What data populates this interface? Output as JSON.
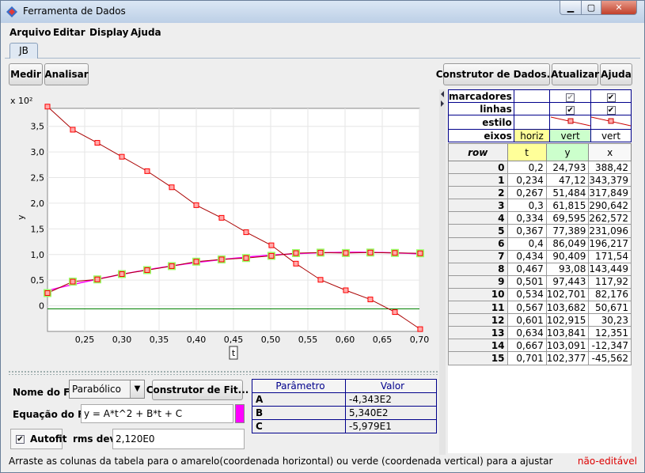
{
  "window": {
    "title": "Ferramenta de Dados"
  },
  "menu": [
    "Arquivo",
    "Editar",
    "Display",
    "Ajuda"
  ],
  "tab": "JB",
  "toolbar": {
    "measure": "Medir",
    "analyze": "Analisar",
    "builder": "Construtor de Dados...",
    "refresh": "Atualizar",
    "help": "Ajuda"
  },
  "props": {
    "rows": [
      "marcadores",
      "linhas",
      "estilo",
      "eixos"
    ],
    "axes": [
      "horiz",
      "vert",
      "vert"
    ]
  },
  "table": {
    "headers": [
      "row",
      "t",
      "y",
      "x"
    ],
    "rows": [
      [
        "0",
        "0,2",
        "24,793",
        "388,42"
      ],
      [
        "1",
        "0,234",
        "47,12",
        "343,379"
      ],
      [
        "2",
        "0,267",
        "51,484",
        "317,849"
      ],
      [
        "3",
        "0,3",
        "61,815",
        "290,642"
      ],
      [
        "4",
        "0,334",
        "69,595",
        "262,572"
      ],
      [
        "5",
        "0,367",
        "77,389",
        "231,096"
      ],
      [
        "6",
        "0,4",
        "86,049",
        "196,217"
      ],
      [
        "7",
        "0,434",
        "90,409",
        "171,54"
      ],
      [
        "8",
        "0,467",
        "93,08",
        "143,449"
      ],
      [
        "9",
        "0,501",
        "97,443",
        "117,92"
      ],
      [
        "10",
        "0,534",
        "102,701",
        "82,176"
      ],
      [
        "11",
        "0,567",
        "103,682",
        "50,671"
      ],
      [
        "12",
        "0,601",
        "102,915",
        "30,23"
      ],
      [
        "13",
        "0,634",
        "103,841",
        "12,351"
      ],
      [
        "14",
        "0,667",
        "103,091",
        "-12,347"
      ],
      [
        "15",
        "0,701",
        "102,377",
        "-45,562"
      ]
    ]
  },
  "fit": {
    "name_label": "Nome do Fit:",
    "name_value": "Parabólico",
    "builder": "Construtor de Fit...",
    "eq_label": "Equação do Fit:",
    "eq_value": "y = A*t^2 + B*t + C",
    "autofit": "Autofit",
    "rms_label": "rms dev:",
    "rms_value": "2,120E0",
    "param_headers": [
      "Parâmetro",
      "Valor"
    ],
    "params": [
      [
        "A",
        "-4,343E2"
      ],
      [
        "B",
        "5,340E2"
      ],
      [
        "C",
        "-5,979E1"
      ]
    ],
    "curve_color": "#ff00ff"
  },
  "status": {
    "text": "Arraste as colunas da tabela para o amarelo(coordenada horizontal) ou verde (coordenada vertical) para a ajustar",
    "editable": "não-editável"
  },
  "chart_data": {
    "type": "line",
    "xlabel": "t",
    "ylabel": "y",
    "ylabel_multiplier": "x 10²",
    "xlim": [
      0.2,
      0.7
    ],
    "ylim": [
      -0.5,
      3.85
    ],
    "xticks": [
      "0,25",
      "0,30",
      "0,35",
      "0,40",
      "0,45",
      "0,50",
      "0,55",
      "0,60",
      "0,65",
      "0,70"
    ],
    "yticks": [
      "0",
      "0,5",
      "1,0",
      "1,5",
      "2,0",
      "2,5",
      "3,0",
      "3,5"
    ],
    "t": [
      0.2,
      0.234,
      0.267,
      0.3,
      0.334,
      0.367,
      0.4,
      0.434,
      0.467,
      0.501,
      0.534,
      0.567,
      0.601,
      0.634,
      0.667,
      0.701
    ],
    "series": [
      {
        "name": "y",
        "values": [
          24.793,
          47.12,
          51.484,
          61.815,
          69.595,
          77.389,
          86.049,
          90.409,
          93.08,
          97.443,
          102.701,
          103.682,
          102.915,
          103.841,
          103.091,
          102.377
        ],
        "color": "#cc0000",
        "highlight": "#99ff66"
      },
      {
        "name": "x",
        "values": [
          388.42,
          343.379,
          317.849,
          290.642,
          262.572,
          231.096,
          196.217,
          171.54,
          143.449,
          117.92,
          82.176,
          50.671,
          30.23,
          12.351,
          -12.347,
          -45.562
        ],
        "color": "#cc0000"
      }
    ],
    "fit": {
      "A": -434.3,
      "B": 534.0,
      "C": -59.79
    },
    "colors": {
      "marker": "#ff0000",
      "line": "#aa0000",
      "fit": "#ff00ff",
      "zero": "#008000"
    }
  }
}
